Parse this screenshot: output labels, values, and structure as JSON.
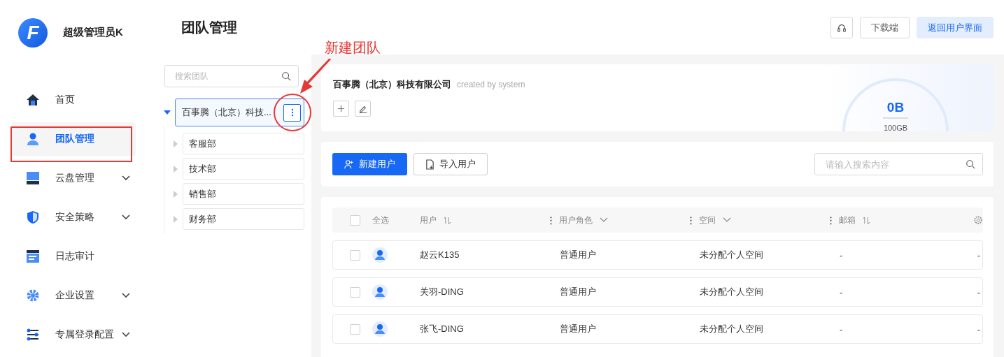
{
  "sidebar": {
    "logo": "F",
    "user": "超级管理员K",
    "items": [
      {
        "label": "首页",
        "selected": false,
        "expandable": false
      },
      {
        "label": "团队管理",
        "selected": true,
        "expandable": false
      },
      {
        "label": "云盘管理",
        "selected": false,
        "expandable": true
      },
      {
        "label": "安全策略",
        "selected": false,
        "expandable": true
      },
      {
        "label": "日志审计",
        "selected": false,
        "expandable": false
      },
      {
        "label": "企业设置",
        "selected": false,
        "expandable": true
      },
      {
        "label": "专属登录配置",
        "selected": false,
        "expandable": true
      }
    ]
  },
  "header": {
    "title": "团队管理",
    "download": "下载端",
    "back": "返回用户界面"
  },
  "teams": {
    "placeholder": "搜索团队",
    "root": {
      "label": "百事腾（北京）科技...",
      "expanded": true,
      "selected": true,
      "children": [
        {
          "label": "客服部",
          "expanded": false
        },
        {
          "label": "技术部",
          "expanded": false
        },
        {
          "label": "销售部",
          "expanded": false
        },
        {
          "label": "财务部",
          "expanded": false
        }
      ]
    }
  },
  "company": {
    "name": "百事腾（北京）科技有限公司",
    "note": "created by system",
    "used": "0B",
    "total": "100GB"
  },
  "toolbar": {
    "new_user": "新建用户",
    "import_user": "导入用户",
    "placeholder": "请输入搜索内容"
  },
  "table": {
    "select_all": "全选",
    "select_all_checked": false,
    "columns": [
      {
        "label": "用户",
        "kind": "sort"
      },
      {
        "label": "用户角色",
        "kind": "filter"
      },
      {
        "label": "空间",
        "kind": "filter"
      },
      {
        "label": "邮箱",
        "kind": "sort"
      }
    ],
    "rows": [
      {
        "checked": false,
        "user": "赵云K135",
        "role": "普通用户",
        "space": "未分配个人空间",
        "email": "-",
        "column_6": "-"
      },
      {
        "checked": false,
        "user": "关羽-DING",
        "role": "普通用户",
        "space": "未分配个人空间",
        "email": "-",
        "column_6": "-"
      },
      {
        "checked": false,
        "user": "张飞-DING",
        "role": "普通用户",
        "space": "未分配个人空间",
        "email": "-",
        "column_6": "-"
      }
    ]
  },
  "annotation": {
    "label": "新建团队"
  }
}
